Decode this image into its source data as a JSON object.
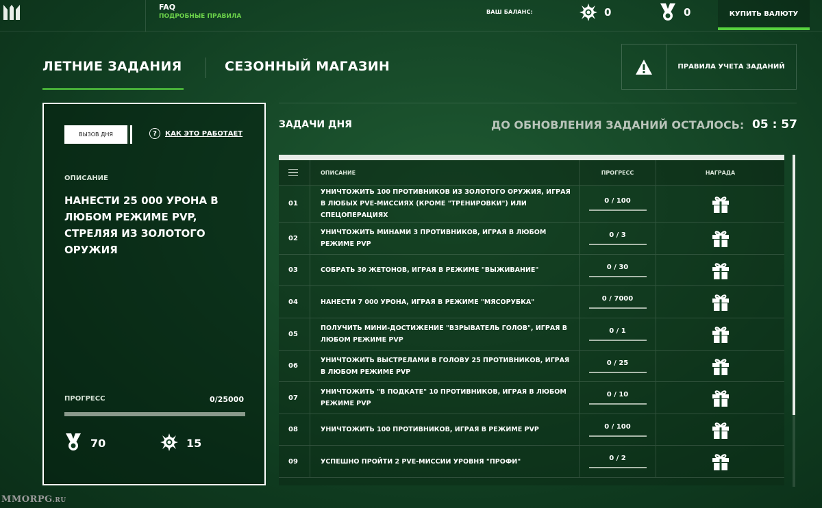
{
  "header": {
    "faq_title": "FAQ",
    "faq_subtitle": "ПОДРОБНЫЕ ПРАВИЛА",
    "balance_label": "ВАШ БАЛАНС:",
    "balance_currency_1": "0",
    "balance_currency_2": "0",
    "buy_label": "КУПИТЬ ВАЛЮТУ",
    "currency_1_icon": "crown-coin-icon",
    "currency_2_icon": "medal-icon"
  },
  "tabs": [
    {
      "label": "ЛЕТНИЕ ЗАДАНИЯ",
      "active": true
    },
    {
      "label": "СЕЗОННЫЙ МАГАЗИН",
      "active": false
    }
  ],
  "rules_button": {
    "label": "ПРАВИЛА УЧЕТА ЗАДАНИЙ",
    "icon": "warning-icon"
  },
  "challenge": {
    "chip_label": "ВЫЗОВ ДНЯ",
    "how_label": "КАК ЭТО РАБОТАЕТ",
    "description_label": "ОПИСАНИЕ",
    "description": "НАНЕСТИ 25 000 УРОНА В ЛЮБОМ РЕЖИМЕ PVP, СТРЕЛЯЯ ИЗ ЗОЛОТОГО ОРУЖИЯ",
    "progress_label": "ПРОГРЕСС",
    "progress_value": "0/25000",
    "progress_fraction": 0,
    "reward_medals": "70",
    "reward_coins": "15"
  },
  "tasks": {
    "title": "ЗАДАЧИ ДНЯ",
    "timer_label": "ДО ОБНОВЛЕНИЯ ЗАДАНИЙ ОСТАЛОСЬ:",
    "timer_value": "05 : 57",
    "columns": {
      "description": "ОПИСАНИЕ",
      "progress": "ПРОГРЕСС",
      "reward": "НАГРАДА"
    },
    "rows": [
      {
        "num": "01",
        "desc": "УНИЧТОЖИТЬ 100 ПРОТИВНИКОВ ИЗ ЗОЛОТОГО ОРУЖИЯ, ИГРАЯ В ЛЮБЫХ PVE-МИССИЯХ (КРОМЕ \"ТРЕНИРОВКИ\") ИЛИ СПЕЦОПЕРАЦИЯХ",
        "progress": "0 / 100"
      },
      {
        "num": "02",
        "desc": "УНИЧТОЖИТЬ МИНАМИ 3 ПРОТИВНИКОВ, ИГРАЯ В ЛЮБОМ РЕЖИМЕ PVP",
        "progress": "0 / 3"
      },
      {
        "num": "03",
        "desc": "СОБРАТЬ 30 ЖЕТОНОВ, ИГРАЯ В РЕЖИМЕ \"ВЫЖИВАНИЕ\"",
        "progress": "0 / 30"
      },
      {
        "num": "04",
        "desc": "НАНЕСТИ 7 000 УРОНА, ИГРАЯ В РЕЖИМЕ \"МЯСОРУБКА\"",
        "progress": "0 / 7000"
      },
      {
        "num": "05",
        "desc": "ПОЛУЧИТЬ МИНИ-ДОСТИЖЕНИЕ \"ВЗРЫВАТЕЛЬ ГОЛОВ\", ИГРАЯ В ЛЮБОМ РЕЖИМЕ PVP",
        "progress": "0 / 1"
      },
      {
        "num": "06",
        "desc": "УНИЧТОЖИТЬ ВЫСТРЕЛАМИ В ГОЛОВУ 25 ПРОТИВНИКОВ, ИГРАЯ В ЛЮБОМ РЕЖИМЕ PVP",
        "progress": "0 / 25"
      },
      {
        "num": "07",
        "desc": "УНИЧТОЖИТЬ \"В ПОДКАТЕ\" 10 ПРОТИВНИКОВ, ИГРАЯ В ЛЮБОМ РЕЖИМЕ PVP",
        "progress": "0 / 10"
      },
      {
        "num": "08",
        "desc": "УНИЧТОЖИТЬ 100 ПРОТИВНИКОВ, ИГРАЯ В РЕЖИМЕ PVP",
        "progress": "0 / 100"
      },
      {
        "num": "09",
        "desc": "УСПЕШНО ПРОЙТИ 2 PVE-МИССИИ УРОВНЯ \"ПРОФИ\"",
        "progress": "0 / 2"
      }
    ]
  },
  "watermark": {
    "main": "MMORPG",
    "suffix": ".RU"
  },
  "colors": {
    "accent": "#57d13f",
    "background": "#174a29"
  }
}
